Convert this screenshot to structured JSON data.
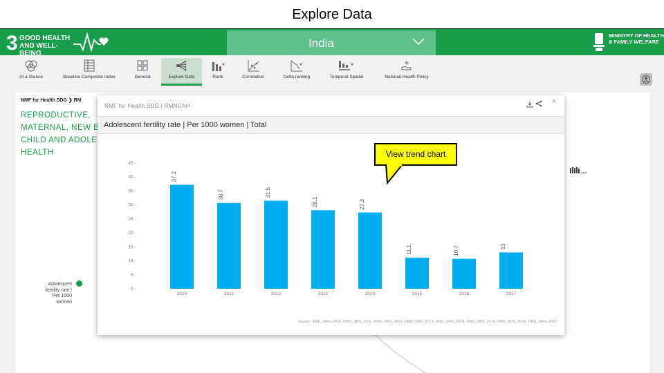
{
  "slide": {
    "title": "Explore Data"
  },
  "header": {
    "sdg_number": "3",
    "sdg_label": "GOOD HEALTH AND WELL-BEING",
    "country": "India",
    "ministry": "MINISTRY OF HEALTH & FAMILY WELFARE",
    "color": "#1a9d4a"
  },
  "nav": {
    "items": [
      {
        "label": "At a Glance",
        "icon": "globe-icon"
      },
      {
        "label": "Baseline Composite Index",
        "icon": "table-icon"
      },
      {
        "label": "General",
        "icon": "grid-icon"
      },
      {
        "label": "Explore Data",
        "icon": "tree-icon",
        "active": true
      },
      {
        "label": "Rank",
        "icon": "bar-chart-icon"
      },
      {
        "label": "Correlation",
        "icon": "scatter-icon"
      },
      {
        "label": "Delta ranking",
        "icon": "trend-icon"
      },
      {
        "label": "Temporal Spatial",
        "icon": "temporal-icon"
      },
      {
        "label": "National Health Policy",
        "icon": "hand-icon"
      }
    ]
  },
  "panel": {
    "breadcrumb": "NMF for Health SDG ❯ RM",
    "theme_title": "REPRODUCTIVE, MATERNAL, NEW B CHILD AND ADOLE HEALTH",
    "node_label": "Adolescent fertility rate | Per 1000 women"
  },
  "modal": {
    "title": "NMF for Health SDG | RMNCAH",
    "subtitle": "Adolescent fertility rate | Per 1000 women | Total",
    "source": "Source: DRD_SRS_2010, DRD_SRS_2011, DRD_SRS_2012, DRD_SRS_2013, DRD_SRS_2014, DRD_SRS_2015, DRD_SRS_2016, DRD_SRS_2017"
  },
  "callout": {
    "text": "View trend chart",
    "color": "#ffff00"
  },
  "chart_data": {
    "type": "bar",
    "categories": [
      "2010",
      "2011",
      "2012",
      "2013",
      "2014",
      "2015",
      "2016",
      "2017"
    ],
    "values": [
      37.2,
      30.7,
      31.5,
      28.1,
      27.3,
      11.1,
      10.7,
      13
    ],
    "data_labels": [
      "37.2",
      "30.7",
      "31.5",
      "28.1",
      "27.3",
      "11.1",
      "10.7",
      "13"
    ],
    "yticks": [
      0,
      5,
      10,
      15,
      20,
      25,
      30,
      35,
      40,
      45
    ],
    "ylim": [
      0,
      45
    ],
    "color": "#00aeef",
    "title": "",
    "xlabel": "",
    "ylabel": ""
  }
}
